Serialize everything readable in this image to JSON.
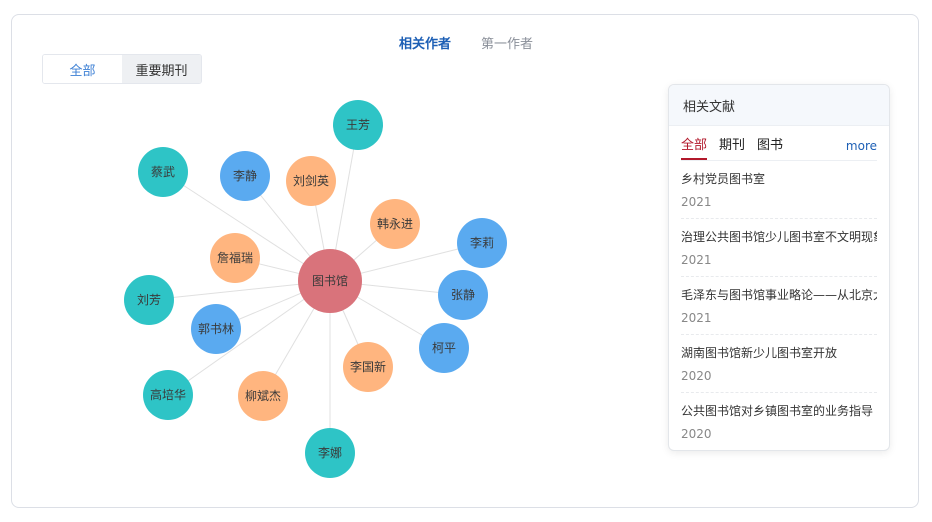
{
  "tabs": {
    "related_authors": "相关作者",
    "first_author": "第一作者"
  },
  "segment": {
    "all": "全部",
    "key_journals": "重要期刊"
  },
  "colors": {
    "center": "#d9737b",
    "teal": "#2ec4c6",
    "blue": "#5aaaf0",
    "orange": "#ffb57f",
    "edge": "#e0e0e0"
  },
  "graph": {
    "center": {
      "label": "图书馆",
      "color": "center"
    },
    "nodes": [
      {
        "label": "王芳",
        "color": "teal"
      },
      {
        "label": "蔡武",
        "color": "teal"
      },
      {
        "label": "李静",
        "color": "blue"
      },
      {
        "label": "刘剑英",
        "color": "orange"
      },
      {
        "label": "韩永进",
        "color": "orange"
      },
      {
        "label": "李莉",
        "color": "blue"
      },
      {
        "label": "詹福瑞",
        "color": "orange"
      },
      {
        "label": "张静",
        "color": "blue"
      },
      {
        "label": "刘芳",
        "color": "teal"
      },
      {
        "label": "郭书林",
        "color": "blue"
      },
      {
        "label": "柯平",
        "color": "blue"
      },
      {
        "label": "李国新",
        "color": "orange"
      },
      {
        "label": "高培华",
        "color": "teal"
      },
      {
        "label": "柳斌杰",
        "color": "orange"
      },
      {
        "label": "李娜",
        "color": "teal"
      }
    ]
  },
  "panel": {
    "title": "相关文献",
    "tabs": [
      "全部",
      "期刊",
      "图书"
    ],
    "more": "more",
    "docs": [
      {
        "title": "乡村党员图书室",
        "year": "2021"
      },
      {
        "title": "治理公共图书馆少儿图书室不文明现象",
        "year": "2021"
      },
      {
        "title": "毛泽东与图书馆事业略论——从北京大学图书馆谈起",
        "year": "2021"
      },
      {
        "title": "湖南图书馆新少儿图书室开放",
        "year": "2020"
      },
      {
        "title": "公共图书馆对乡镇图书室的业务指导",
        "year": "2020"
      }
    ]
  }
}
